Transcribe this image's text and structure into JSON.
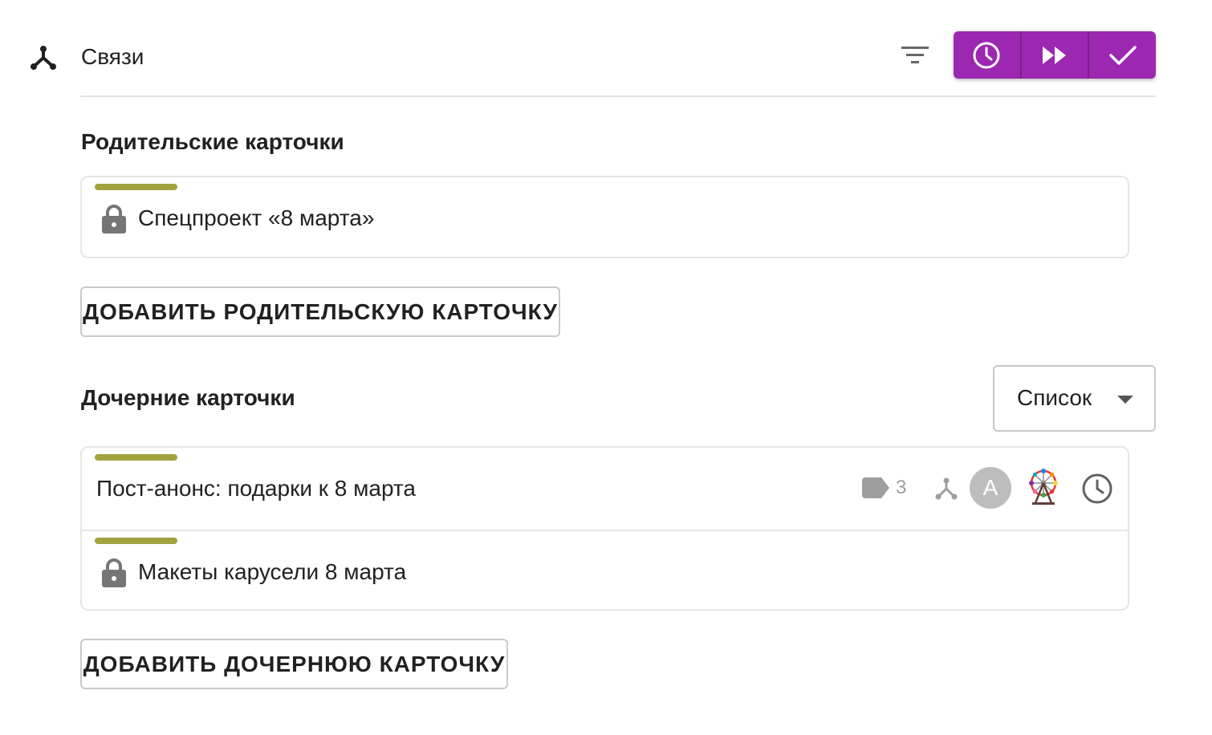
{
  "header": {
    "title": "Связи",
    "accent_color": "#9c27b0",
    "icons": [
      "relations-icon",
      "filter-icon",
      "clock-icon",
      "fast-forward-icon",
      "check-icon"
    ]
  },
  "parents": {
    "heading": "Родительские карточки",
    "cards": [
      {
        "title": "Спецпроект «8 марта»",
        "locked": true,
        "strip_color": "#a1a33e"
      }
    ],
    "add_button": "ДОБАВИТЬ РОДИТЕЛЬСКУЮ КАРТОЧКУ"
  },
  "children": {
    "heading": "Дочерние карточки",
    "view_select": {
      "value": "Список"
    },
    "cards": [
      {
        "title": "Пост-анонс: подарки к 8 марта",
        "locked": false,
        "strip_color": "#a1a33e",
        "tag_count": "3",
        "avatar_letter": "A",
        "icons": [
          "tag-icon",
          "relations-icon",
          "ferris-wheel-icon",
          "clock-icon"
        ]
      },
      {
        "title": "Макеты карусели 8 марта",
        "locked": true,
        "strip_color": "#a1a33e"
      }
    ],
    "add_button": "ДОБАВИТЬ ДОЧЕРНЮЮ КАРТОЧКУ"
  }
}
